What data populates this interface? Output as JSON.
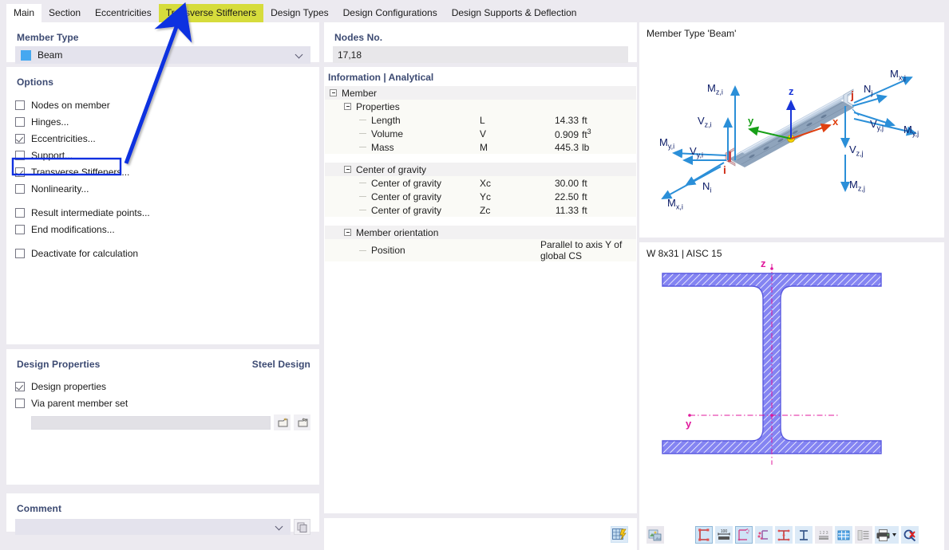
{
  "tabs": [
    {
      "label": "Main",
      "state": "active"
    },
    {
      "label": "Section",
      "state": "normal"
    },
    {
      "label": "Eccentricities",
      "state": "normal"
    },
    {
      "label": "Transverse Stiffeners",
      "state": "highlighted"
    },
    {
      "label": "Design Types",
      "state": "normal"
    },
    {
      "label": "Design Configurations",
      "state": "normal"
    },
    {
      "label": "Design Supports & Deflection",
      "state": "normal"
    }
  ],
  "member_type": {
    "group_label": "Member Type",
    "selected": "Beam",
    "swatch_color": "#45a8f0",
    "dropdown_icon": "chevron-down-icon"
  },
  "options": {
    "group_label": "Options",
    "items": [
      {
        "label": "Nodes on member",
        "checked": false
      },
      {
        "label": "Hinges...",
        "checked": false
      },
      {
        "label": "Eccentricities...",
        "checked": true
      },
      {
        "label": "Support...",
        "checked": false
      },
      {
        "label": "Transverse Stiffeners...",
        "checked": true,
        "highlighted": true
      },
      {
        "label": "Nonlinearity...",
        "checked": false
      },
      {
        "label": "Result intermediate points...",
        "checked": false,
        "gap_before": true
      },
      {
        "label": "End modifications...",
        "checked": false
      },
      {
        "label": "Deactivate for calculation",
        "checked": false,
        "gap_before": true
      }
    ]
  },
  "design_properties": {
    "group_label": "Design Properties",
    "right_label": "Steel Design",
    "items": [
      {
        "label": "Design properties",
        "checked": true
      },
      {
        "label": "Via parent member set",
        "checked": false
      }
    ],
    "input_value": "",
    "buttons": [
      "new-member-set-icon",
      "edit-member-set-icon"
    ]
  },
  "comment": {
    "group_label": "Comment",
    "value": "",
    "dropdown_icon": "chevron-down-icon",
    "button_icon": "copy-comment-icon"
  },
  "nodes": {
    "group_label": "Nodes No.",
    "value": "17,18"
  },
  "information": {
    "header": "Information | Analytical",
    "tree": [
      {
        "level": 0,
        "type": "group",
        "name": "Member",
        "expander": "minus"
      },
      {
        "level": 1,
        "type": "group",
        "name": "Properties",
        "expander": "minus"
      },
      {
        "level": 2,
        "type": "leaf",
        "name": "Length",
        "symbol": "L",
        "value": "14.33",
        "unit": "ft"
      },
      {
        "level": 2,
        "type": "leaf",
        "name": "Volume",
        "symbol": "V",
        "value": "0.909",
        "unit": "ft3",
        "unit_sup": "3",
        "unit_base": "ft"
      },
      {
        "level": 2,
        "type": "leaf",
        "name": "Mass",
        "symbol": "M",
        "value": "445.3",
        "unit": "lb"
      },
      {
        "level": 0,
        "type": "gap"
      },
      {
        "level": 1,
        "type": "group",
        "name": "Center of gravity",
        "expander": "minus"
      },
      {
        "level": 2,
        "type": "leaf",
        "name": "Center of gravity",
        "symbol": "Xc",
        "value": "30.00",
        "unit": "ft"
      },
      {
        "level": 2,
        "type": "leaf",
        "name": "Center of gravity",
        "symbol": "Yc",
        "value": "22.50",
        "unit": "ft"
      },
      {
        "level": 2,
        "type": "leaf",
        "name": "Center of gravity",
        "symbol": "Zc",
        "value": "11.33",
        "unit": "ft"
      },
      {
        "level": 0,
        "type": "gap"
      },
      {
        "level": 1,
        "type": "group",
        "name": "Member orientation",
        "expander": "minus"
      },
      {
        "level": 2,
        "type": "leaf",
        "name": "Position",
        "symbol": "",
        "value": "",
        "unit": "",
        "wide_value": "Parallel to axis Y of global CS"
      }
    ],
    "grid_button_icon": "table-lightning-icon"
  },
  "viewer_3d": {
    "title": "Member Type 'Beam'",
    "node_labels": [
      "i",
      "j"
    ],
    "axis_labels": [
      {
        "label": "z",
        "color": "#1835d8"
      },
      {
        "label": "y",
        "color": "#18a018"
      },
      {
        "label": "x",
        "color": "#e04010"
      }
    ],
    "force_labels": [
      {
        "label": "Mz,i",
        "base": "M",
        "sub": "z,i"
      },
      {
        "label": "Vz,i",
        "base": "V",
        "sub": "z,i"
      },
      {
        "label": "My,i",
        "base": "M",
        "sub": "y,i"
      },
      {
        "label": "Vy,i",
        "base": "V",
        "sub": "y,i"
      },
      {
        "label": "Ni",
        "base": "N",
        "sub": "i"
      },
      {
        "label": "Mx,i",
        "base": "M",
        "sub": "x,i"
      },
      {
        "label": "Mx,j",
        "base": "M",
        "sub": "x,j"
      },
      {
        "label": "Nj",
        "base": "N",
        "sub": "j"
      },
      {
        "label": "Vy,j",
        "base": "V",
        "sub": "y,j"
      },
      {
        "label": "My,j",
        "base": "M",
        "sub": "y,j"
      },
      {
        "label": "Vz,j",
        "base": "V",
        "sub": "z,j"
      },
      {
        "label": "Mz,j",
        "base": "M",
        "sub": "z,j"
      }
    ],
    "arrow_color": "#2b8fd8"
  },
  "cross_section": {
    "title": "W 8x31 | AISC 15",
    "axis_z_label": "z",
    "axis_y_label": "y",
    "fill_color": "#7b7bf0",
    "axis_color": "#e0189c"
  },
  "bottom_toolbar": {
    "buttons": [
      {
        "name": "render-mode-icon",
        "style": "plain"
      },
      {
        "name": "section-dimensions-icon",
        "style": "sel"
      },
      {
        "name": "section-measure-icon",
        "style": "normal"
      },
      {
        "name": "section-axes-icon",
        "style": "sel"
      },
      {
        "name": "section-stress-points-icon",
        "style": "normal"
      },
      {
        "name": "section-parts-icon",
        "style": "normal"
      },
      {
        "name": "section-outline-icon",
        "style": "normal"
      },
      {
        "name": "section-numbering-icon",
        "style": "dim"
      },
      {
        "name": "section-grid-icon",
        "style": "normal"
      },
      {
        "name": "section-table-icon",
        "style": "dim"
      },
      {
        "name": "print-icon",
        "style": "normal"
      },
      {
        "name": "reset-view-icon",
        "style": "normal"
      }
    ]
  },
  "annotation": {
    "arrow_color": "#1030e0",
    "highlight_border_color": "#1030e0"
  }
}
